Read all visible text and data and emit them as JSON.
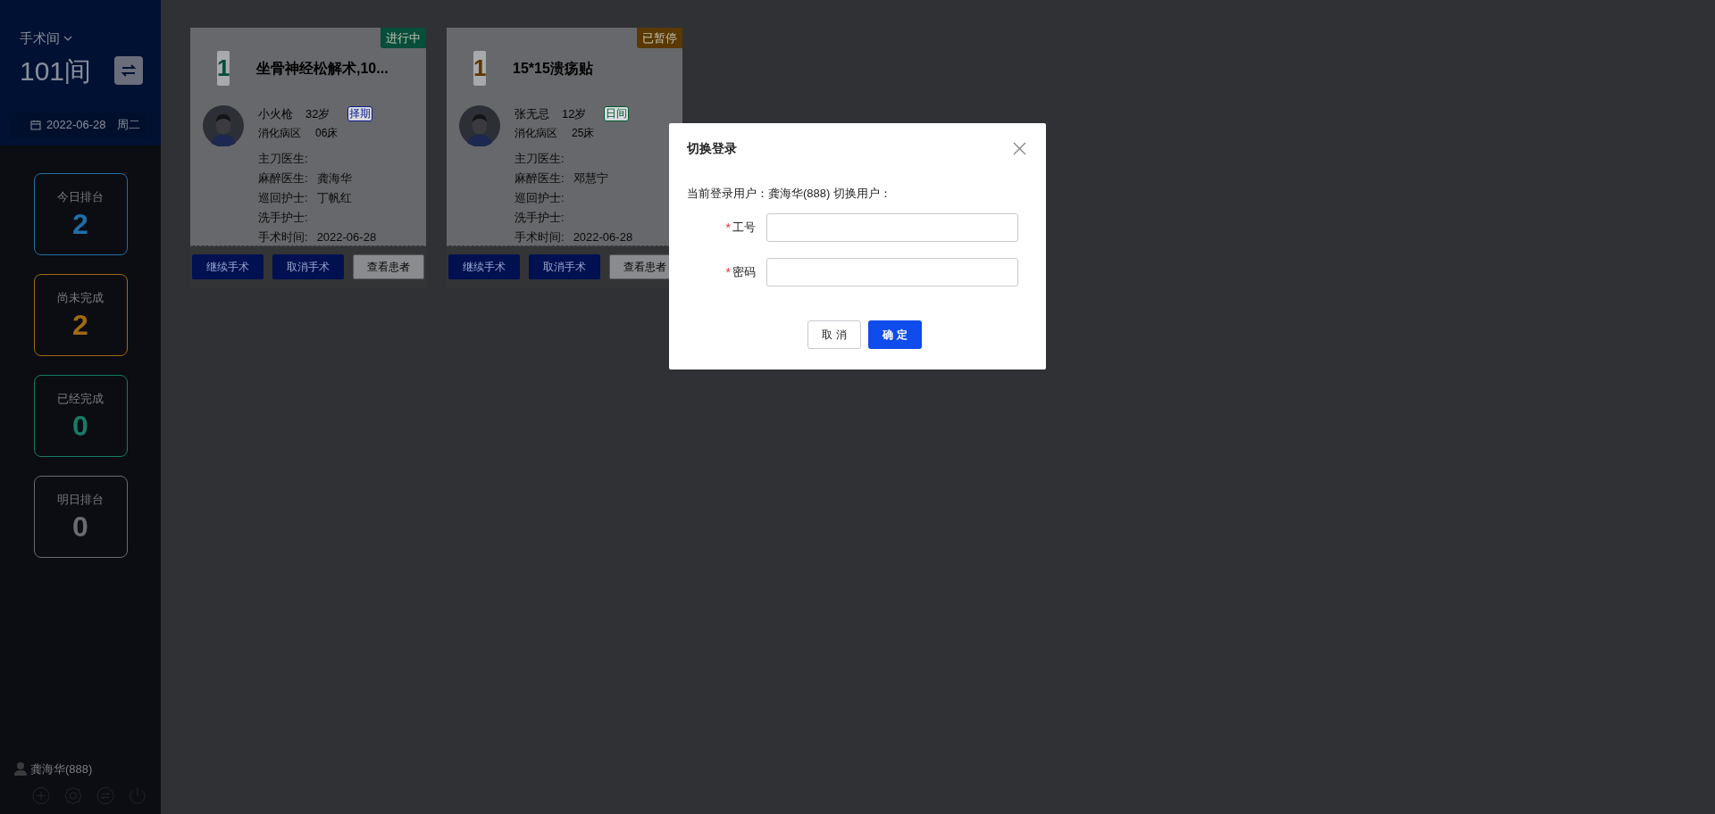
{
  "sidebar": {
    "room_label": "手术间",
    "room": "101间",
    "date": "2022-06-28",
    "weekday": "周二",
    "stats": [
      {
        "label": "今日排台",
        "value": "2",
        "color": "#1f6fa8"
      },
      {
        "label": "尚未完成",
        "value": "2",
        "color": "#a06a14"
      },
      {
        "label": "已经完成",
        "value": "0",
        "color": "#167a66"
      },
      {
        "label": "明日排台",
        "value": "0",
        "color": "#6a6b6e"
      }
    ],
    "user": "龚海华(888)"
  },
  "cards": [
    {
      "number": "1",
      "title": "坐骨神经松解术,10...",
      "status": "进行中",
      "color": "#064d3a",
      "patient": "小火枪",
      "age": "32岁",
      "tag": {
        "text": "择期",
        "color": "#0a1a8a"
      },
      "ward": "消化病区",
      "bed": "06床",
      "fields": [
        {
          "label": "主刀医生:"
        },
        {
          "label": "麻醉医生:",
          "value": "龚海华"
        },
        {
          "label": "巡回护士:",
          "value": "丁帆红"
        },
        {
          "label": "洗手护士:"
        },
        {
          "label": "手术时间:",
          "value": "2022-06-28"
        }
      ],
      "buttons": [
        "继续手术",
        "取消手术",
        "查看患者"
      ]
    },
    {
      "number": "1",
      "title": "15*15溃疡贴",
      "status": "已暂停",
      "color": "#5a3800",
      "patient": "张无忌",
      "age": "12岁",
      "tag": {
        "text": "日间",
        "color": "#005a28"
      },
      "ward": "消化病区",
      "bed": "25床",
      "fields": [
        {
          "label": "主刀医生:"
        },
        {
          "label": "麻醉医生:",
          "value": "邓慧宁"
        },
        {
          "label": "巡回护士:"
        },
        {
          "label": "洗手护士:"
        },
        {
          "label": "手术时间:",
          "value": "2022-06-28"
        }
      ],
      "buttons": [
        "继续手术",
        "取消手术",
        "查看患者"
      ]
    }
  ],
  "dialog": {
    "title": "切换登录",
    "info": "当前登录用户：龚海华(888) 切换用户：",
    "fields": [
      {
        "label": "工号",
        "required_mark": "*"
      },
      {
        "label": "密码",
        "required_mark": "*"
      }
    ],
    "buttons": [
      {
        "label": "取 消",
        "kind": "secondary"
      },
      {
        "label": "确 定",
        "kind": "primary"
      }
    ]
  }
}
